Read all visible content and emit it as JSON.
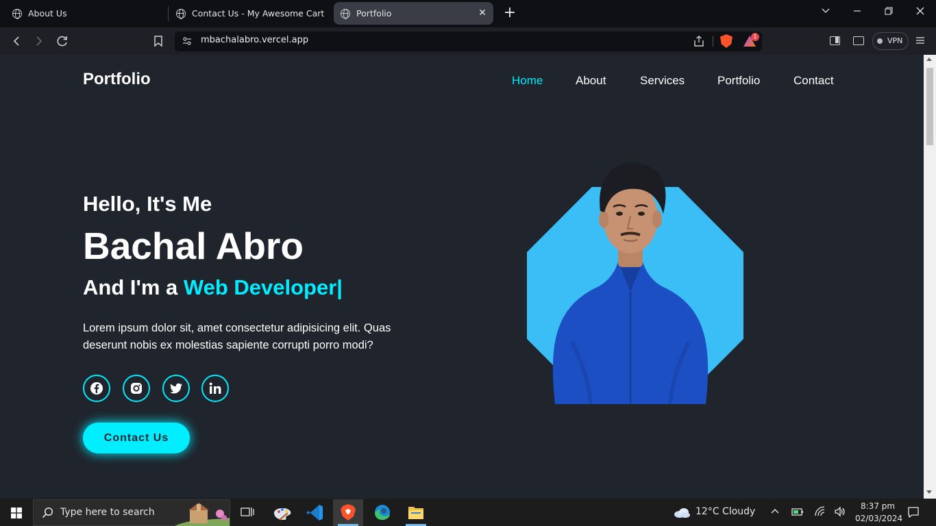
{
  "browser": {
    "tabs": [
      {
        "title": "About Us"
      },
      {
        "title": "Contact Us - My Awesome Cart"
      },
      {
        "title": "Portfolio"
      }
    ],
    "url": "mbachalabro.vercel.app",
    "vpn_label": "VPN",
    "rewards_badge": "1",
    "close_glyph": "✕",
    "new_tab_glyph": "+"
  },
  "site": {
    "logo": "Portfolio",
    "nav": [
      {
        "label": "Home",
        "active": true
      },
      {
        "label": "About",
        "active": false
      },
      {
        "label": "Services",
        "active": false
      },
      {
        "label": "Portfolio",
        "active": false
      },
      {
        "label": "Contact",
        "active": false
      }
    ],
    "hero": {
      "greeting": "Hello, It's Me",
      "name": "Bachal Abro",
      "role_prefix": "And I'm a ",
      "role_highlight": "Web Developer|",
      "bio": "Lorem ipsum dolor sit, amet consectetur adipisicing elit. Quas deserunt nobis ex molestias sapiente corrupti porro modi?",
      "cta": "Contact Us",
      "socials": [
        "facebook-icon",
        "instagram-icon",
        "twitter-icon",
        "linkedin-icon"
      ]
    },
    "accent_color": "#00eeff",
    "background_color": "#1f242d"
  },
  "taskbar": {
    "search_placeholder": "Type here to search",
    "weather": "12°C  Cloudy",
    "time": "8:37 pm",
    "date": "02/03/2024"
  }
}
